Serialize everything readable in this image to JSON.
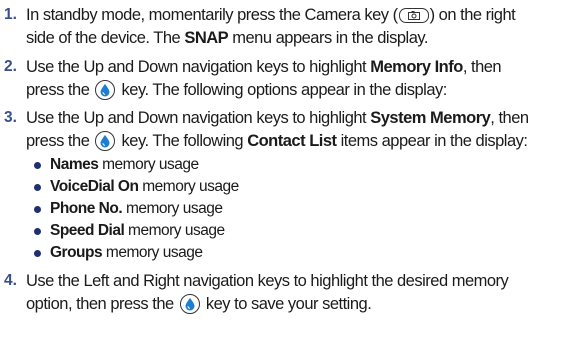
{
  "steps": [
    {
      "number": "1.",
      "line1_a": "In standby mode, momentarily press the Camera key (",
      "line1_b": ") on the right",
      "line2_a": "side of the device. The ",
      "line2_bold": "SNAP",
      "line2_b": " menu appears in the display."
    },
    {
      "number": "2.",
      "line1_a": "Use the Up and Down navigation keys to highlight ",
      "line1_bold": "Memory Info",
      "line1_b": ", then",
      "line2_a": "press the ",
      "line2_b": " key. The following options appear in the display:"
    },
    {
      "number": "3.",
      "line1_a": "Use the Up and Down navigation keys to highlight ",
      "line1_bold": "System Memory",
      "line1_b": ", then",
      "line2_a": "press the ",
      "line2_b": " key. The following ",
      "line2_bold": "Contact List",
      "line2_c": " items appear in the display:"
    },
    {
      "number": "4.",
      "line1_a": "Use the Left and Right navigation keys to highlight the desired memory",
      "line2_a": "option, then press the ",
      "line2_b": " key to save your setting."
    }
  ],
  "bullets": [
    {
      "bold": "Names",
      "rest": " memory usage"
    },
    {
      "bold": "VoiceDial On",
      "rest": " memory usage"
    },
    {
      "bold": "Phone No.",
      "rest": " memory usage"
    },
    {
      "bold": "Speed Dial",
      "rest": " memory usage"
    },
    {
      "bold": "Groups",
      "rest": " memory usage"
    }
  ],
  "icons": {
    "camera_key": "camera-key-icon",
    "ok_key": "ok-key-icon"
  },
  "colors": {
    "step_number": "#3a4f8a",
    "bullet": "#1f2f6f",
    "ok_drop": "#1e7fd0"
  }
}
